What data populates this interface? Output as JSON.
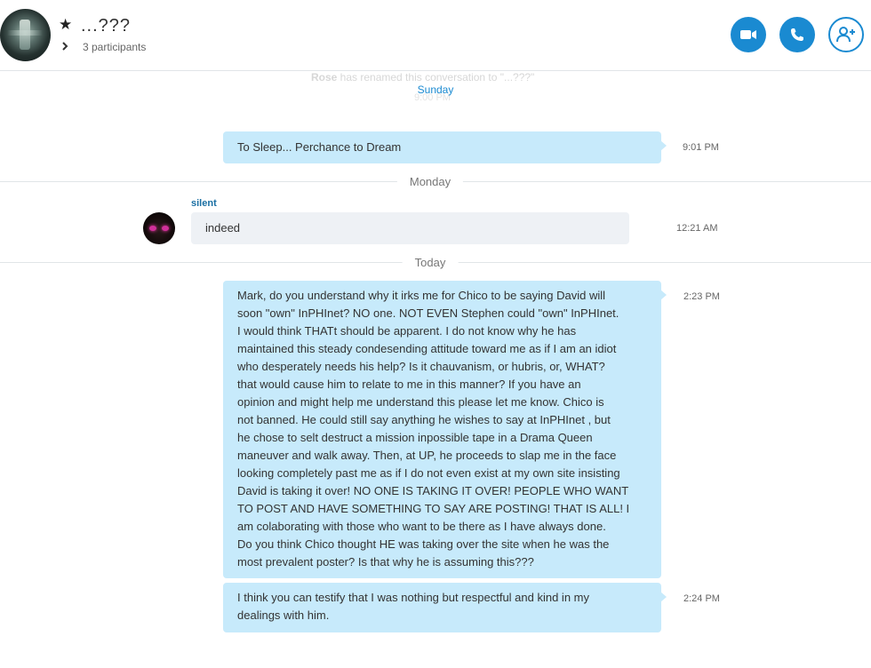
{
  "header": {
    "title": "...???",
    "participants": "3 participants"
  },
  "system": {
    "renamer": "Rose",
    "rename_text": " has renamed this conversation to \"...???\"",
    "rename_time": "9:00 PM"
  },
  "days": {
    "sunday": "Sunday",
    "monday": "Monday",
    "today": "Today"
  },
  "messages": [
    {
      "text": "To Sleep... Perchance to Dream",
      "time": "9:01 PM"
    },
    {
      "sender": "silent",
      "text": "indeed",
      "time": "12:21 AM"
    },
    {
      "text": "Mark, do you understand why it irks me for Chico to be saying David will\nsoon \"own\" InPHInet?  NO one.  NOT EVEN Stephen could \"own\" InPHInet.\nI would think THATt should be apparent.  I do not know why he has\nmaintained this steady condesending attitude toward me as if I am an idiot\nwho desperately needs his help?  Is it chauvanism, or hubris, or, WHAT?\nthat would cause him to relate to me in this manner?  If you have an\nopinion and might help me understand this please let me know.  Chico is\nnot banned.  He could still say anything he wishes to say at InPHInet , but\nhe chose to selt destruct a mission inpossible tape in a Drama Queen\nmaneuver and walk away.  Then, at UP, he proceeds to slap me in the face\nlooking completely past me as if I do not even exist at my own site insisting\nDavid is taking it over!  NO ONE IS TAKING IT OVER! PEOPLE WHO WANT\nTO POST AND HAVE SOMETHING TO SAY ARE POSTING!  THAT IS ALL!  I\nam colaborating with those who want to be there as I have always done.\nDo you think Chico thought HE was taking over the site when he was the\nmost prevalent poster?  Is that why he is assuming this???",
      "time": "2:23 PM"
    },
    {
      "text": "I think you can testify that I was nothing but respectful and kind in my\ndealings with him.",
      "time": "2:24 PM"
    }
  ],
  "colors": {
    "accent": "#1a8ad1",
    "outgoing_bubble": "#c7eafb",
    "incoming_bubble": "#eef1f5"
  },
  "icons": [
    "group-avatar",
    "star-icon",
    "chevron-right-icon",
    "video-call-icon",
    "audio-call-icon",
    "add-participant-icon",
    "user-avatar"
  ]
}
